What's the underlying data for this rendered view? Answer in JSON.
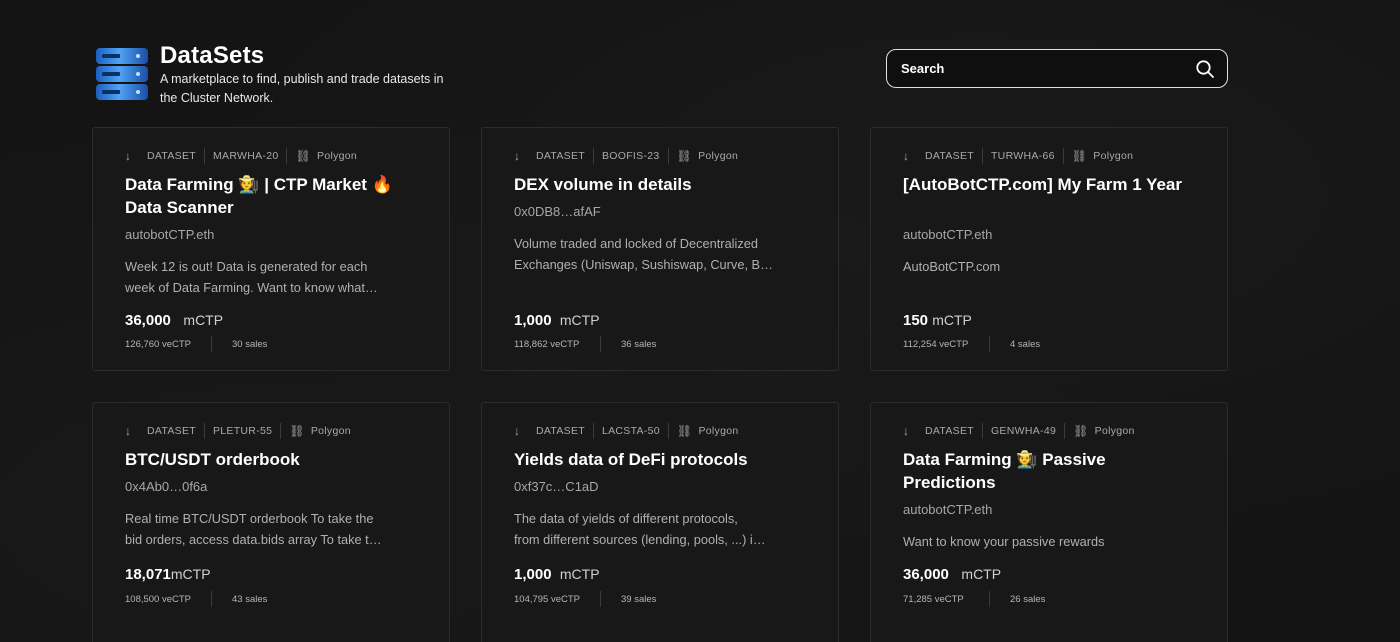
{
  "header": {
    "title": "DataSets",
    "subtitle": "A marketplace to find, publish and trade datasets in the Cluster Network.",
    "logo_icon": "database-icon"
  },
  "search": {
    "placeholder": "Search",
    "icon": "search-icon"
  },
  "cards": [
    {
      "type": "DATASET",
      "symbol": "MARWHA-20",
      "chain": "Polygon",
      "title": "Data Farming 🧑‍🌾 | CTP Market 🔥 Data Scanner",
      "owner": "autobotCTP.eth",
      "desc1": "Week 12 is out! Data is generated for each",
      "desc2": "week of Data Farming. Want to know what…",
      "price": "36,000",
      "unit": "mCTP",
      "vectp": "126,760 veCTP",
      "sales": "30 sales"
    },
    {
      "type": "DATASET",
      "symbol": "BOOFIS-23",
      "chain": "Polygon",
      "title": "DEX volume in details",
      "owner": "0x0DB8…afAF",
      "desc1": "Volume traded and locked of Decentralized",
      "desc2": "Exchanges (Uniswap, Sushiswap, Curve, B…",
      "price": "1,000",
      "unit": "mCTP",
      "vectp": "118,862 veCTP",
      "sales": "36 sales"
    },
    {
      "type": "DATASET",
      "symbol": "TURWHA-66",
      "chain": "Polygon",
      "title": "[AutoBotCTP.com] My Farm 1 Year",
      "owner": "autobotCTP.eth",
      "desc1": "AutoBotCTP.com",
      "desc2": "",
      "price": "150",
      "unit": "mCTP",
      "vectp": "112,254 veCTP",
      "sales": "4 sales"
    },
    {
      "type": "DATASET",
      "symbol": "PLETUR-55",
      "chain": "Polygon",
      "title": "BTC/USDT orderbook",
      "owner": "0x4Ab0…0f6a",
      "desc1": "Real time BTC/USDT orderbook To take the",
      "desc2": "bid orders, access data.bids array To take t…",
      "price": "18,071",
      "unit": "mCTP",
      "vectp": "108,500 veCTP",
      "sales": "43 sales"
    },
    {
      "type": "DATASET",
      "symbol": "LACSTA-50",
      "chain": "Polygon",
      "title": "Yields data of DeFi protocols",
      "owner": "0xf37c…C1aD",
      "desc1": "The data of yields of different protocols,",
      "desc2": "from different sources (lending, pools, ...) i…",
      "price": "1,000",
      "unit": "mCTP",
      "vectp": "104,795 veCTP",
      "sales": "39 sales"
    },
    {
      "type": "DATASET",
      "symbol": "GENWHA-49",
      "chain": "Polygon",
      "title": "Data Farming 🧑‍🌾 Passive Predictions",
      "owner": "autobotCTP.eth",
      "desc1": "Want to know your passive rewards",
      "desc2": "",
      "price": "36,000",
      "unit": "mCTP",
      "vectp": "71,285 veCTP",
      "sales": "26 sales"
    }
  ]
}
